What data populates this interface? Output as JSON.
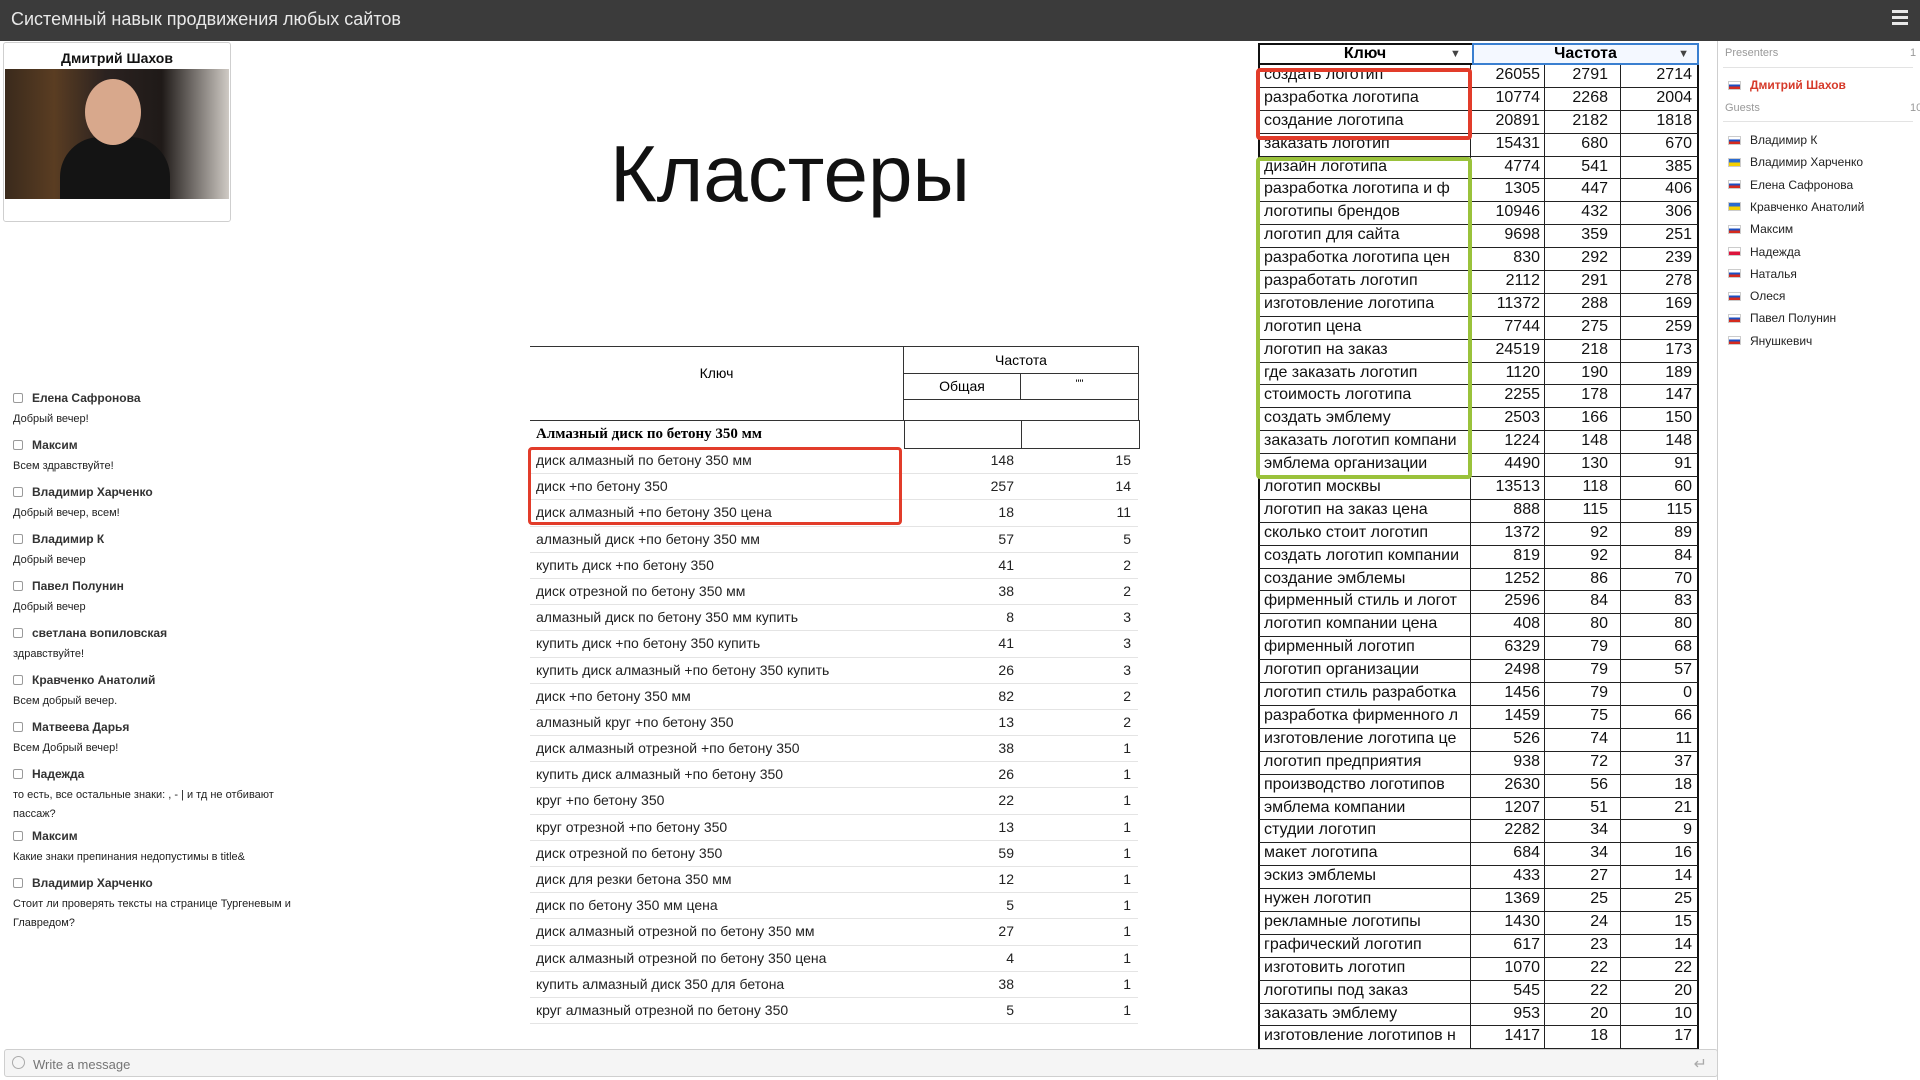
{
  "app": {
    "title": "Системный навык продвижения любых сайтов"
  },
  "video": {
    "presenter_name": "Дмитрий Шахов"
  },
  "chat": {
    "placeholder": "Write a message",
    "messages": [
      {
        "author": "Елена Сафронова",
        "text": "Добрый вечер!"
      },
      {
        "author": "Максим",
        "text": "Всем здравствуйте!"
      },
      {
        "author": "Владимир Харченко",
        "text": "Добрый вечер, всем!"
      },
      {
        "author": "Владимир К",
        "text": "Добрый вечер"
      },
      {
        "author": "Павел Полунин",
        "text": "Добрый вечер"
      },
      {
        "author": "светлана вопиловская",
        "text": "здравствуйте!"
      },
      {
        "author": "Кравченко Анатолий",
        "text": "Всем добрый вечер."
      },
      {
        "author": "Матвеева Дарья",
        "text": "Всем Добрый вечер!"
      },
      {
        "author": "Надежда",
        "text": "то есть, все остальные знаки: , - | и тд не отбивают пассаж?"
      },
      {
        "author": "Максим",
        "text": "Какие знаки препинания недопустимы в title&"
      },
      {
        "author": "Владимир Харченко",
        "text": "Стоит ли проверять тексты на странице Тургеневым и Главредом?"
      }
    ]
  },
  "slide": {
    "title": "Кластеры",
    "left_table": {
      "col_key": "Ключ",
      "col_freq": "Частота",
      "col_total": "Общая",
      "col_exact": "\"\"",
      "group": "Алмазный диск по бетону 350 мм",
      "rows": [
        [
          "диск алмазный по бетону 350 мм",
          "148",
          "15"
        ],
        [
          "диск +по бетону 350",
          "257",
          "14"
        ],
        [
          "диск алмазный +по бетону 350 цена",
          "18",
          "11"
        ],
        [
          "алмазный диск +по бетону 350 мм",
          "57",
          "5"
        ],
        [
          "купить диск +по бетону 350",
          "41",
          "2"
        ],
        [
          "диск отрезной по бетону 350 мм",
          "38",
          "2"
        ],
        [
          "алмазный диск по бетону 350 мм купить",
          "8",
          "3"
        ],
        [
          "купить диск +по бетону 350 купить",
          "41",
          "3"
        ],
        [
          "купить диск алмазный +по бетону 350 купить",
          "26",
          "3"
        ],
        [
          "диск +по бетону 350 мм",
          "82",
          "2"
        ],
        [
          "алмазный круг +по бетону 350",
          "13",
          "2"
        ],
        [
          "диск алмазный отрезной +по бетону 350",
          "38",
          "1"
        ],
        [
          "купить диск алмазный +по бетону 350",
          "26",
          "1"
        ],
        [
          "круг +по бетону 350",
          "22",
          "1"
        ],
        [
          "круг отрезной +по бетону 350",
          "13",
          "1"
        ],
        [
          "диск отрезной по бетону 350",
          "59",
          "1"
        ],
        [
          "диск для резки бетона 350 мм",
          "12",
          "1"
        ],
        [
          "диск по бетону 350 мм цена",
          "5",
          "1"
        ],
        [
          "диск алмазный отрезной по бетону 350 мм",
          "27",
          "1"
        ],
        [
          "диск алмазный отрезной по бетону 350 цена",
          "4",
          "1"
        ],
        [
          "купить алмазный диск 350 для бетона",
          "38",
          "1"
        ],
        [
          "круг алмазный отрезной по бетону 350",
          "5",
          "1"
        ]
      ]
    },
    "right_table": {
      "col_key": "Ключ",
      "col_freq": "Частота",
      "rows": [
        [
          "создать логотип",
          "26055",
          "2791",
          "2714"
        ],
        [
          "разработка логотипа",
          "10774",
          "2268",
          "2004"
        ],
        [
          "создание логотипа",
          "20891",
          "2182",
          "1818"
        ],
        [
          "заказать логотип",
          "15431",
          "680",
          "670"
        ],
        [
          "дизайн логотипа",
          "4774",
          "541",
          "385"
        ],
        [
          "разработка логотипа и ф",
          "1305",
          "447",
          "406"
        ],
        [
          "логотипы брендов",
          "10946",
          "432",
          "306"
        ],
        [
          "логотип для сайта",
          "9698",
          "359",
          "251"
        ],
        [
          "разработка логотипа цен",
          "830",
          "292",
          "239"
        ],
        [
          "разработать логотип",
          "2112",
          "291",
          "278"
        ],
        [
          "изготовление логотипа",
          "11372",
          "288",
          "169"
        ],
        [
          "логотип цена",
          "7744",
          "275",
          "259"
        ],
        [
          "логотип на заказ",
          "24519",
          "218",
          "173"
        ],
        [
          "где заказать логотип",
          "1120",
          "190",
          "189"
        ],
        [
          "стоимость логотипа",
          "2255",
          "178",
          "147"
        ],
        [
          "создать эмблему",
          "2503",
          "166",
          "150"
        ],
        [
          "заказать логотип компани",
          "1224",
          "148",
          "148"
        ],
        [
          "эмблема организации",
          "4490",
          "130",
          "91"
        ],
        [
          "логотип москвы",
          "13513",
          "118",
          "60"
        ],
        [
          "логотип на заказ цена",
          "888",
          "115",
          "115"
        ],
        [
          "сколько стоит логотип",
          "1372",
          "92",
          "89"
        ],
        [
          "создать логотип компании",
          "819",
          "92",
          "84"
        ],
        [
          "создание эмблемы",
          "1252",
          "86",
          "70"
        ],
        [
          "фирменный стиль и логот",
          "2596",
          "84",
          "83"
        ],
        [
          "логотип компании цена",
          "408",
          "80",
          "80"
        ],
        [
          "фирменный логотип",
          "6329",
          "79",
          "68"
        ],
        [
          "логотип организации",
          "2498",
          "79",
          "57"
        ],
        [
          "логотип стиль разработка",
          "1456",
          "79",
          "0"
        ],
        [
          "разработка фирменного л",
          "1459",
          "75",
          "66"
        ],
        [
          "изготовление логотипа це",
          "526",
          "74",
          "11"
        ],
        [
          "логотип предприятия",
          "938",
          "72",
          "37"
        ],
        [
          "производство логотипов",
          "2630",
          "56",
          "18"
        ],
        [
          "эмблема компании",
          "1207",
          "51",
          "21"
        ],
        [
          "студии логотип",
          "2282",
          "34",
          "9"
        ],
        [
          "макет логотипа",
          "684",
          "34",
          "16"
        ],
        [
          "эскиз эмблемы",
          "433",
          "27",
          "14"
        ],
        [
          "нужен логотип",
          "1369",
          "25",
          "25"
        ],
        [
          "рекламные логотипы",
          "1430",
          "24",
          "15"
        ],
        [
          "графический логотип",
          "617",
          "23",
          "14"
        ],
        [
          "изготовить логотип",
          "1070",
          "22",
          "22"
        ],
        [
          "логотипы под заказ",
          "545",
          "22",
          "20"
        ],
        [
          "заказать эмблему",
          "953",
          "20",
          "10"
        ],
        [
          "изготовление логотипов н",
          "1417",
          "18",
          "17"
        ]
      ]
    }
  },
  "participants": {
    "presenters_label": "Presenters",
    "presenters_count": "1",
    "guests_label": "Guests",
    "guests_count": "10",
    "presenters": [
      {
        "name": "Дмитрий Шахов",
        "flag": "ru"
      }
    ],
    "guests": [
      {
        "name": "Владимир К",
        "flag": "ru"
      },
      {
        "name": "Владимир Харченко",
        "flag": "ua"
      },
      {
        "name": "Елена Сафронова",
        "flag": "ru"
      },
      {
        "name": "Кравченко Анатолий",
        "flag": "ua"
      },
      {
        "name": "Максим",
        "flag": "ru"
      },
      {
        "name": "Надежда",
        "flag": "pl"
      },
      {
        "name": "Наталья",
        "flag": "ru"
      },
      {
        "name": "Олеся",
        "flag": "ru"
      },
      {
        "name": "Павел Полунин",
        "flag": "ru"
      },
      {
        "name": "Янушкевич",
        "flag": "ru"
      }
    ]
  },
  "colors": {
    "topbar": "#3b3b3b",
    "highlight_red": "#e23c2a",
    "highlight_green": "#9ac23b",
    "presenter_name": "#d63a2a"
  }
}
